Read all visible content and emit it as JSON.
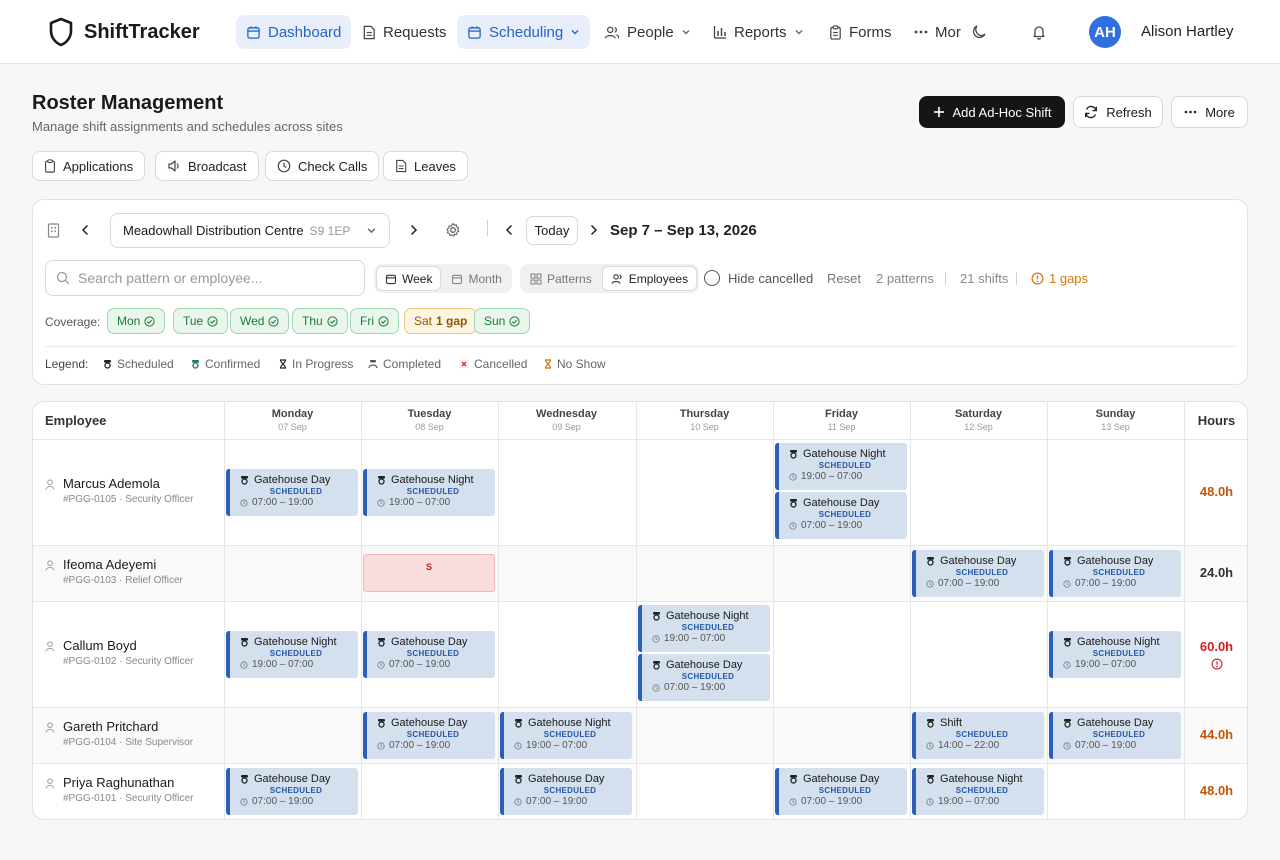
{
  "app": {
    "name": "ShiftTracker",
    "user_name": "Alison Hartley",
    "user_initials": "AH"
  },
  "nav": {
    "dashboard": "Dashboard",
    "requests": "Requests",
    "scheduling": "Scheduling",
    "people": "People",
    "reports": "Reports",
    "forms": "Forms",
    "more": "Mor"
  },
  "page": {
    "title": "Roster Management",
    "subtitle": "Manage shift assignments and schedules across sites"
  },
  "actions": {
    "add": "Add Ad-Hoc Shift",
    "refresh": "Refresh",
    "more": "More"
  },
  "subnav": {
    "applications": "Applications",
    "broadcast": "Broadcast",
    "check_calls": "Check Calls",
    "leaves": "Leaves"
  },
  "toolbar": {
    "site": "Meadowhall Distribution Centre",
    "site_code": "S9 1EP",
    "today": "Today",
    "date_range": "Sep 7 – Sep 13, 2026",
    "search_placeholder": "Search pattern or employee...",
    "week": "Week",
    "month": "Month",
    "patterns": "Patterns",
    "employees": "Employees",
    "hide_cancelled": "Hide cancelled",
    "reset": "Reset",
    "patterns_count": "2 patterns",
    "shifts_count": "21 shifts",
    "gaps": "1 gaps"
  },
  "coverage": {
    "label": "Coverage:",
    "days": [
      {
        "day": "Mon",
        "status": "ok"
      },
      {
        "day": "Tue",
        "status": "ok"
      },
      {
        "day": "Wed",
        "status": "ok"
      },
      {
        "day": "Thu",
        "status": "ok"
      },
      {
        "day": "Fri",
        "status": "ok"
      },
      {
        "day": "Sat",
        "status": "gap",
        "note": "1 gap"
      },
      {
        "day": "Sun",
        "status": "ok"
      }
    ]
  },
  "legend": {
    "label": "Legend:",
    "items": [
      "Scheduled",
      "Confirmed",
      "In Progress",
      "Completed",
      "Cancelled",
      "No Show"
    ]
  },
  "grid": {
    "employee_header": "Employee",
    "hours_header": "Hours",
    "columns": [
      {
        "day": "Monday",
        "date": "07 Sep"
      },
      {
        "day": "Tuesday",
        "date": "08 Sep"
      },
      {
        "day": "Wednesday",
        "date": "09 Sep"
      },
      {
        "day": "Thursday",
        "date": "10 Sep"
      },
      {
        "day": "Friday",
        "date": "11 Sep"
      },
      {
        "day": "Saturday",
        "date": "12 Sep"
      },
      {
        "day": "Sunday",
        "date": "13 Sep"
      }
    ],
    "employees": [
      {
        "name": "Marcus Ademola",
        "meta": "#PGG-0105 · Security Officer",
        "hours": "48.0h",
        "hours_color": "#c2570c"
      },
      {
        "name": "Ifeoma Adeyemi",
        "meta": "#PGG-0103 · Relief Officer",
        "hours": "24.0h",
        "hours_color": "#333333"
      },
      {
        "name": "Callum Boyd",
        "meta": "#PGG-0102 · Security Officer",
        "hours": "60.0h",
        "hours_color": "#d42020"
      },
      {
        "name": "Gareth Pritchard",
        "meta": "#PGG-0104 · Site Supervisor",
        "hours": "44.0h",
        "hours_color": "#c2570c"
      },
      {
        "name": "Priya Raghunathan",
        "meta": "#PGG-0101 · Security Officer",
        "hours": "48.0h",
        "hours_color": "#c2570c"
      }
    ],
    "shifts": [
      {
        "row": 0,
        "col": 0,
        "slot": "only",
        "title": "Gatehouse Day",
        "status": "SCHEDULED",
        "time": "07:00 – 19:00"
      },
      {
        "row": 0,
        "col": 1,
        "slot": "only",
        "title": "Gatehouse Night",
        "status": "SCHEDULED",
        "time": "19:00 – 07:00"
      },
      {
        "row": 0,
        "col": 4,
        "slot": "top",
        "title": "Gatehouse Night",
        "status": "SCHEDULED",
        "time": "19:00 – 07:00"
      },
      {
        "row": 0,
        "col": 4,
        "slot": "bottom",
        "title": "Gatehouse Day",
        "status": "SCHEDULED",
        "time": "07:00 – 19:00"
      },
      {
        "row": 1,
        "col": 5,
        "slot": "only",
        "title": "Gatehouse Day",
        "status": "SCHEDULED",
        "time": "07:00 – 19:00"
      },
      {
        "row": 1,
        "col": 6,
        "slot": "only",
        "title": "Gatehouse Day",
        "status": "SCHEDULED",
        "time": "07:00 – 19:00"
      },
      {
        "row": 2,
        "col": 0,
        "slot": "only",
        "title": "Gatehouse Night",
        "status": "SCHEDULED",
        "time": "19:00 – 07:00"
      },
      {
        "row": 2,
        "col": 1,
        "slot": "only",
        "title": "Gatehouse Day",
        "status": "SCHEDULED",
        "time": "07:00 – 19:00"
      },
      {
        "row": 2,
        "col": 3,
        "slot": "top",
        "title": "Gatehouse Night",
        "status": "SCHEDULED",
        "time": "19:00 – 07:00"
      },
      {
        "row": 2,
        "col": 3,
        "slot": "bottom",
        "title": "Gatehouse Day",
        "status": "SCHEDULED",
        "time": "07:00 – 19:00"
      },
      {
        "row": 2,
        "col": 6,
        "slot": "only",
        "title": "Gatehouse Night",
        "status": "SCHEDULED",
        "time": "19:00 – 07:00"
      },
      {
        "row": 3,
        "col": 1,
        "slot": "only",
        "title": "Gatehouse Day",
        "status": "SCHEDULED",
        "time": "07:00 – 19:00"
      },
      {
        "row": 3,
        "col": 2,
        "slot": "only",
        "title": "Gatehouse Night",
        "status": "SCHEDULED",
        "time": "19:00 – 07:00"
      },
      {
        "row": 3,
        "col": 5,
        "slot": "only",
        "title": "Shift",
        "status": "SCHEDULED",
        "time": "14:00 – 22:00"
      },
      {
        "row": 3,
        "col": 6,
        "slot": "only",
        "title": "Gatehouse Day",
        "status": "SCHEDULED",
        "time": "07:00 – 19:00"
      },
      {
        "row": 4,
        "col": 0,
        "slot": "only",
        "title": "Gatehouse Day",
        "status": "SCHEDULED",
        "time": "07:00 – 19:00"
      },
      {
        "row": 4,
        "col": 2,
        "slot": "only",
        "title": "Gatehouse Day",
        "status": "SCHEDULED",
        "time": "07:00 – 19:00"
      },
      {
        "row": 4,
        "col": 4,
        "slot": "only",
        "title": "Gatehouse Day",
        "status": "SCHEDULED",
        "time": "07:00 – 19:00"
      },
      {
        "row": 4,
        "col": 5,
        "slot": "only",
        "title": "Gatehouse Night",
        "status": "SCHEDULED",
        "time": "19:00 – 07:00"
      }
    ],
    "cancelled": [
      {
        "row": 1,
        "col": 1,
        "label": "S"
      }
    ]
  }
}
